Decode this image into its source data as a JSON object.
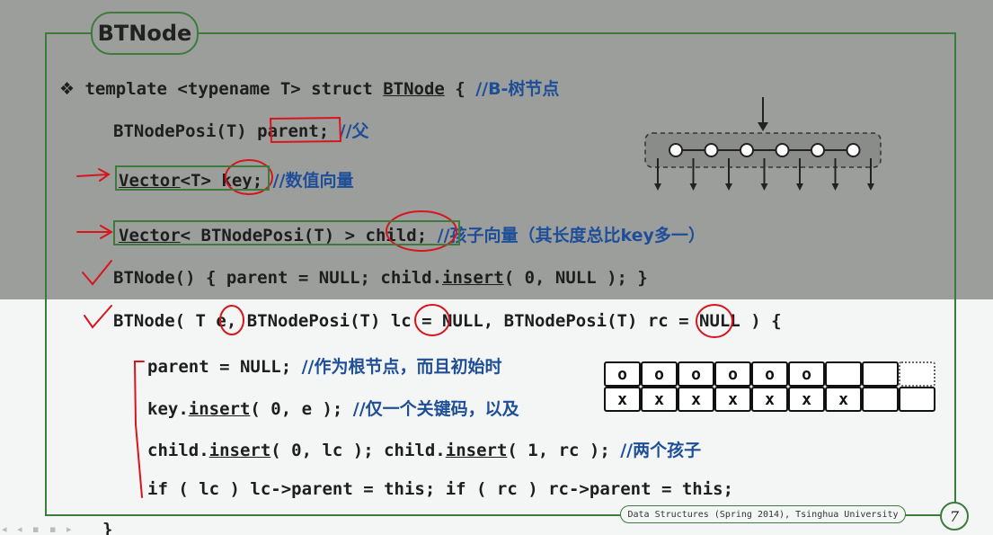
{
  "slide": {
    "title": "BTNode",
    "page_number": "7",
    "footer": "Data Structures (Spring 2014), Tsinghua University",
    "controls": "◂ ◂ ▪ ▪ ▸"
  },
  "code": {
    "line1": {
      "bullet": "❖",
      "pre": " template <typename T> struct ",
      "struct_name": "BTNode",
      "post": " { ",
      "comment": "//B-树节点"
    },
    "line2": {
      "code": "BTNodePosi(T) parent; ",
      "comment": "//父"
    },
    "line3": {
      "vector": "Vector",
      "code": "<T> key; ",
      "comment": "//数值向量"
    },
    "line4": {
      "vector": "Vector",
      "code": "< BTNodePosi(T) > child; ",
      "comment": "//孩子向量（其长度总比key多一）"
    },
    "line5": {
      "pre": "BTNode() { parent = NULL; child.",
      "insert": "insert",
      "post": "( 0, NULL ); }"
    },
    "line6": {
      "code": "BTNode( T e, BTNodePosi(T) lc = NULL, BTNodePosi(T) rc = NULL ) {"
    },
    "line7": {
      "code": "parent = NULL; ",
      "comment": "//作为根节点，而且初始时"
    },
    "line8": {
      "pre": "key.",
      "insert": "insert",
      "post": "( 0, e ); ",
      "comment": "//仅一个关键码，以及"
    },
    "line9": {
      "pre": "child.",
      "insert1": "insert",
      "mid": "( 0, lc ); child.",
      "insert2": "insert",
      "post": "( 1, rc ); ",
      "comment": "//两个孩子"
    },
    "line10": {
      "code": "if ( lc ) lc->parent = this; if ( rc ) rc->parent = this;"
    },
    "closing": "}"
  },
  "key_grid": {
    "row1": [
      "o",
      "o",
      "o",
      "o",
      "o",
      "o",
      "",
      "",
      ""
    ],
    "row2": [
      "x",
      "x",
      "x",
      "x",
      "x",
      "x",
      "x",
      "",
      ""
    ]
  },
  "colors": {
    "frame_green": "#3d7a3d",
    "comment_blue": "#1f4e99",
    "annotation_red": "#d8141c",
    "dim_overlay": "#9c9e9c"
  }
}
